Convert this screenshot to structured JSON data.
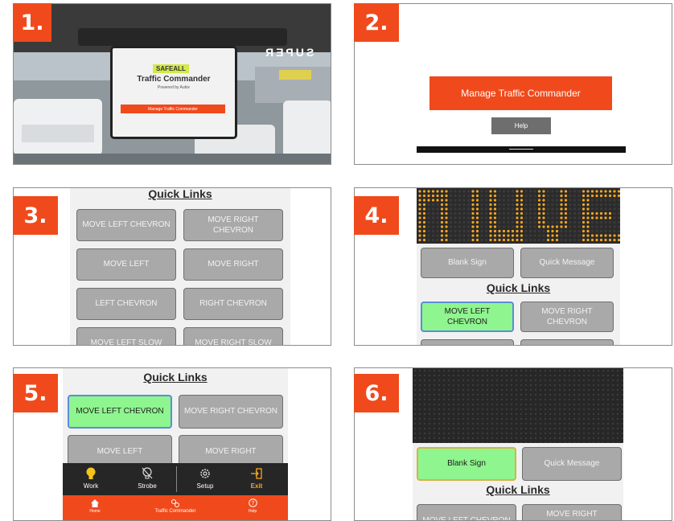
{
  "steps": [
    "1.",
    "2.",
    "3.",
    "4.",
    "5.",
    "6."
  ],
  "panel1": {
    "brand": "SAFEALL",
    "title": "Traffic Commander",
    "subtitle": "Powered by Aubix",
    "button": "Manage Traffic Commander",
    "truck_text": "SUPER"
  },
  "panel2": {
    "manage_label": "Manage Traffic Commander",
    "help_label": "Help"
  },
  "quick_links_title": "Quick Links",
  "quick_links": {
    "move_left_chevron": "MOVE LEFT CHEVRON",
    "move_right_chevron": "MOVE RIGHT CHEVRON",
    "move_left": "MOVE LEFT",
    "move_right": "MOVE RIGHT",
    "left_chevron": "LEFT CHEVRON",
    "right_chevron": "RIGHT CHEVRON",
    "move_left_slow": "MOVE LEFT SLOW",
    "move_right_slow": "MOVE RIGHT SLOW"
  },
  "sign_controls": {
    "blank_sign": "Blank Sign",
    "quick_message": "Quick Message"
  },
  "toolbar": {
    "work": "Work",
    "strobe": "Strobe",
    "setup": "Setup",
    "exit": "Exit"
  },
  "bottom_nav": {
    "home": "Home",
    "traffic_commander": "Traffic Commander",
    "help": "Help"
  },
  "colors": {
    "accent": "#f04a1c",
    "active_green": "#8ff58f",
    "led_amber": "#f5a623",
    "button_grey": "#a9a9a9"
  }
}
